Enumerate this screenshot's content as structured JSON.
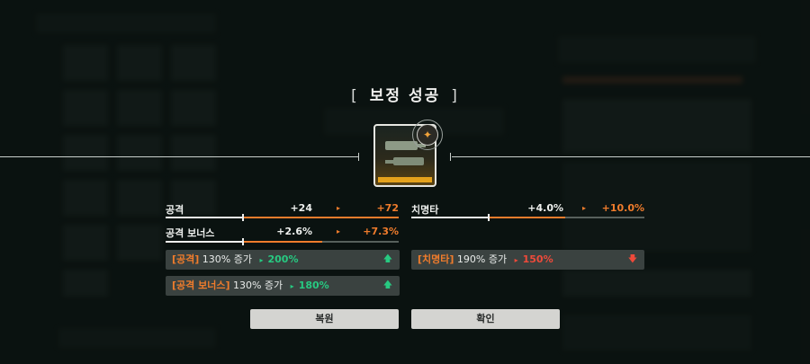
{
  "dialog": {
    "title_left_bracket": "[",
    "title": "보정 성공",
    "title_right_bracket": "]"
  },
  "item": {
    "icon": "weapon-item-icon",
    "badge_icon": "enhance-badge-icon"
  },
  "stats": [
    {
      "label": "공격",
      "from": "+24",
      "to": "+72",
      "arrow": "▸"
    },
    {
      "label": "치명타",
      "from": "+4.0%",
      "to": "+10.0%",
      "arrow": "▸"
    },
    {
      "label": "공격 보너스",
      "from": "+2.6%",
      "to": "+7.3%",
      "arrow": "▸"
    }
  ],
  "effects": [
    {
      "tag": "[공격]",
      "base": "130% 증가",
      "arrow": "▸",
      "new": "200%",
      "trend": "up",
      "indicator": "🡅"
    },
    {
      "tag": "[치명타]",
      "base": "190% 증가",
      "arrow": "▸",
      "new": "150%",
      "trend": "down",
      "indicator": "🡇"
    },
    {
      "tag": "[공격 보너스]",
      "base": "130% 증가",
      "arrow": "▸",
      "new": "180%",
      "trend": "up",
      "indicator": "🡅"
    }
  ],
  "buttons": {
    "restore": "복원",
    "confirm": "확인"
  },
  "colors": {
    "accent_orange": "#f07c2c",
    "increase_green": "#27c981",
    "decrease_red": "#ee4a3a",
    "item_gold": "#e5a21c"
  }
}
